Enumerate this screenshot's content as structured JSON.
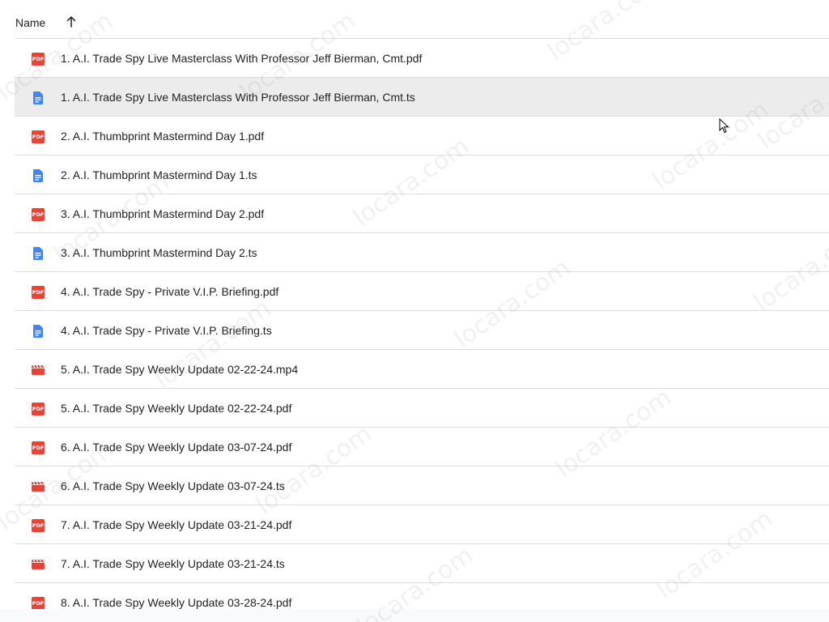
{
  "header": {
    "name_label": "Name",
    "sort_direction": "ascending",
    "sort_icon": "arrow-up-icon"
  },
  "watermark_text": "locara.com",
  "colors": {
    "pdf": "#ea4335",
    "doc": "#4285f4",
    "video": "#ea4335",
    "selected_row": "#ececec",
    "divider": "#dadce0"
  },
  "files": [
    {
      "name": "1. A.I. Trade Spy Live Masterclass With Professor Jeff Bierman, Cmt.pdf",
      "type": "pdf",
      "selected": false
    },
    {
      "name": "1. A.I. Trade Spy Live Masterclass With Professor Jeff Bierman, Cmt.ts",
      "type": "doc",
      "selected": true
    },
    {
      "name": "2. A.I. Thumbprint Mastermind Day 1.pdf",
      "type": "pdf",
      "selected": false
    },
    {
      "name": "2. A.I. Thumbprint Mastermind Day 1.ts",
      "type": "doc",
      "selected": false
    },
    {
      "name": "3. A.I. Thumbprint Mastermind Day 2.pdf",
      "type": "pdf",
      "selected": false
    },
    {
      "name": "3. A.I. Thumbprint Mastermind Day 2.ts",
      "type": "doc",
      "selected": false
    },
    {
      "name": "4. A.I. Trade Spy - Private V.I.P. Briefing.pdf",
      "type": "pdf",
      "selected": false
    },
    {
      "name": "4. A.I. Trade Spy - Private V.I.P. Briefing.ts",
      "type": "doc",
      "selected": false
    },
    {
      "name": "5. A.I. Trade Spy Weekly Update 02-22-24.mp4",
      "type": "video",
      "selected": false
    },
    {
      "name": "5. A.I. Trade Spy Weekly Update 02-22-24.pdf",
      "type": "pdf",
      "selected": false
    },
    {
      "name": "6. A.I. Trade Spy Weekly Update 03-07-24.pdf",
      "type": "pdf",
      "selected": false
    },
    {
      "name": "6. A.I. Trade Spy Weekly Update 03-07-24.ts",
      "type": "video",
      "selected": false
    },
    {
      "name": "7. A.I. Trade Spy Weekly Update 03-21-24.pdf",
      "type": "pdf",
      "selected": false
    },
    {
      "name": "7. A.I. Trade Spy Weekly Update 03-21-24.ts",
      "type": "video",
      "selected": false
    },
    {
      "name": "8. A.I. Trade Spy Weekly Update 03-28-24.pdf",
      "type": "pdf",
      "selected": false
    }
  ]
}
